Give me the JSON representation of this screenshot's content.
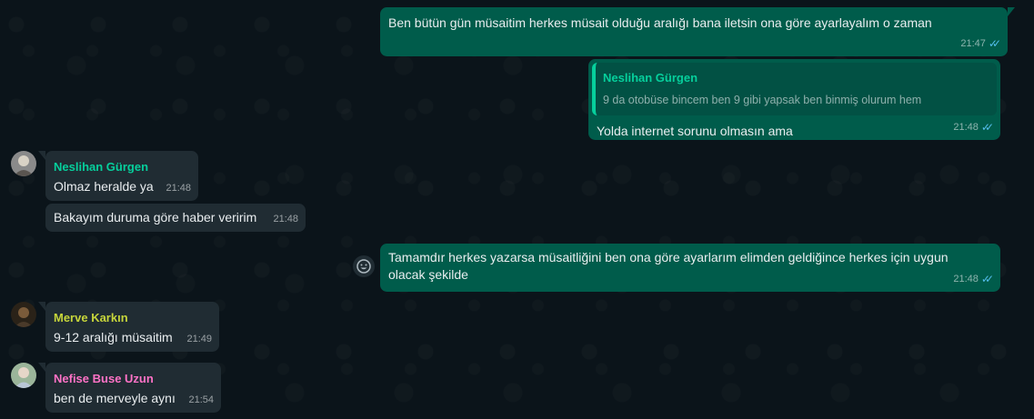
{
  "messages": {
    "m1": {
      "text": "Ben bütün gün müsaitim herkes müsait olduğu aralığı bana iletsin ona göre ayarlayalım o zaman",
      "time": "21:47"
    },
    "m2": {
      "quote_sender": "Neslihan Gürgen",
      "quote_text": "9 da otobüse bincem ben 9 gibi yapsak ben binmiş olurum hem",
      "text": "Yolda internet sorunu olmasın ama",
      "time": "21:48"
    },
    "m3": {
      "sender": "Neslihan Gürgen",
      "text": "Olmaz heralde ya",
      "time": "21:48"
    },
    "m4": {
      "text": "Bakayım duruma göre haber veririm",
      "time": "21:48"
    },
    "m5": {
      "text": "Tamamdır herkes yazarsa müsaitliğini ben ona göre ayarlarım elimden geldiğince herkes için uygun olacak şekilde",
      "time": "21:48"
    },
    "m6": {
      "sender": "Merve Karkın",
      "text": "9-12 aralığı müsaitim",
      "time": "21:49"
    },
    "m7": {
      "sender": "Nefise Buse Uzun",
      "text": "ben de merveyle aynı",
      "time": "21:54"
    }
  },
  "colors": {
    "outgoing_bubble": "#005c4b",
    "incoming_bubble": "#202c33",
    "neslihan": "#06cf9c",
    "merve": "#c6d53b",
    "nefise": "#ff72c6",
    "read_ticks": "#53bdeb"
  },
  "icons": {
    "read_status": "double-check-icon",
    "reaction": "emoji-icon"
  }
}
